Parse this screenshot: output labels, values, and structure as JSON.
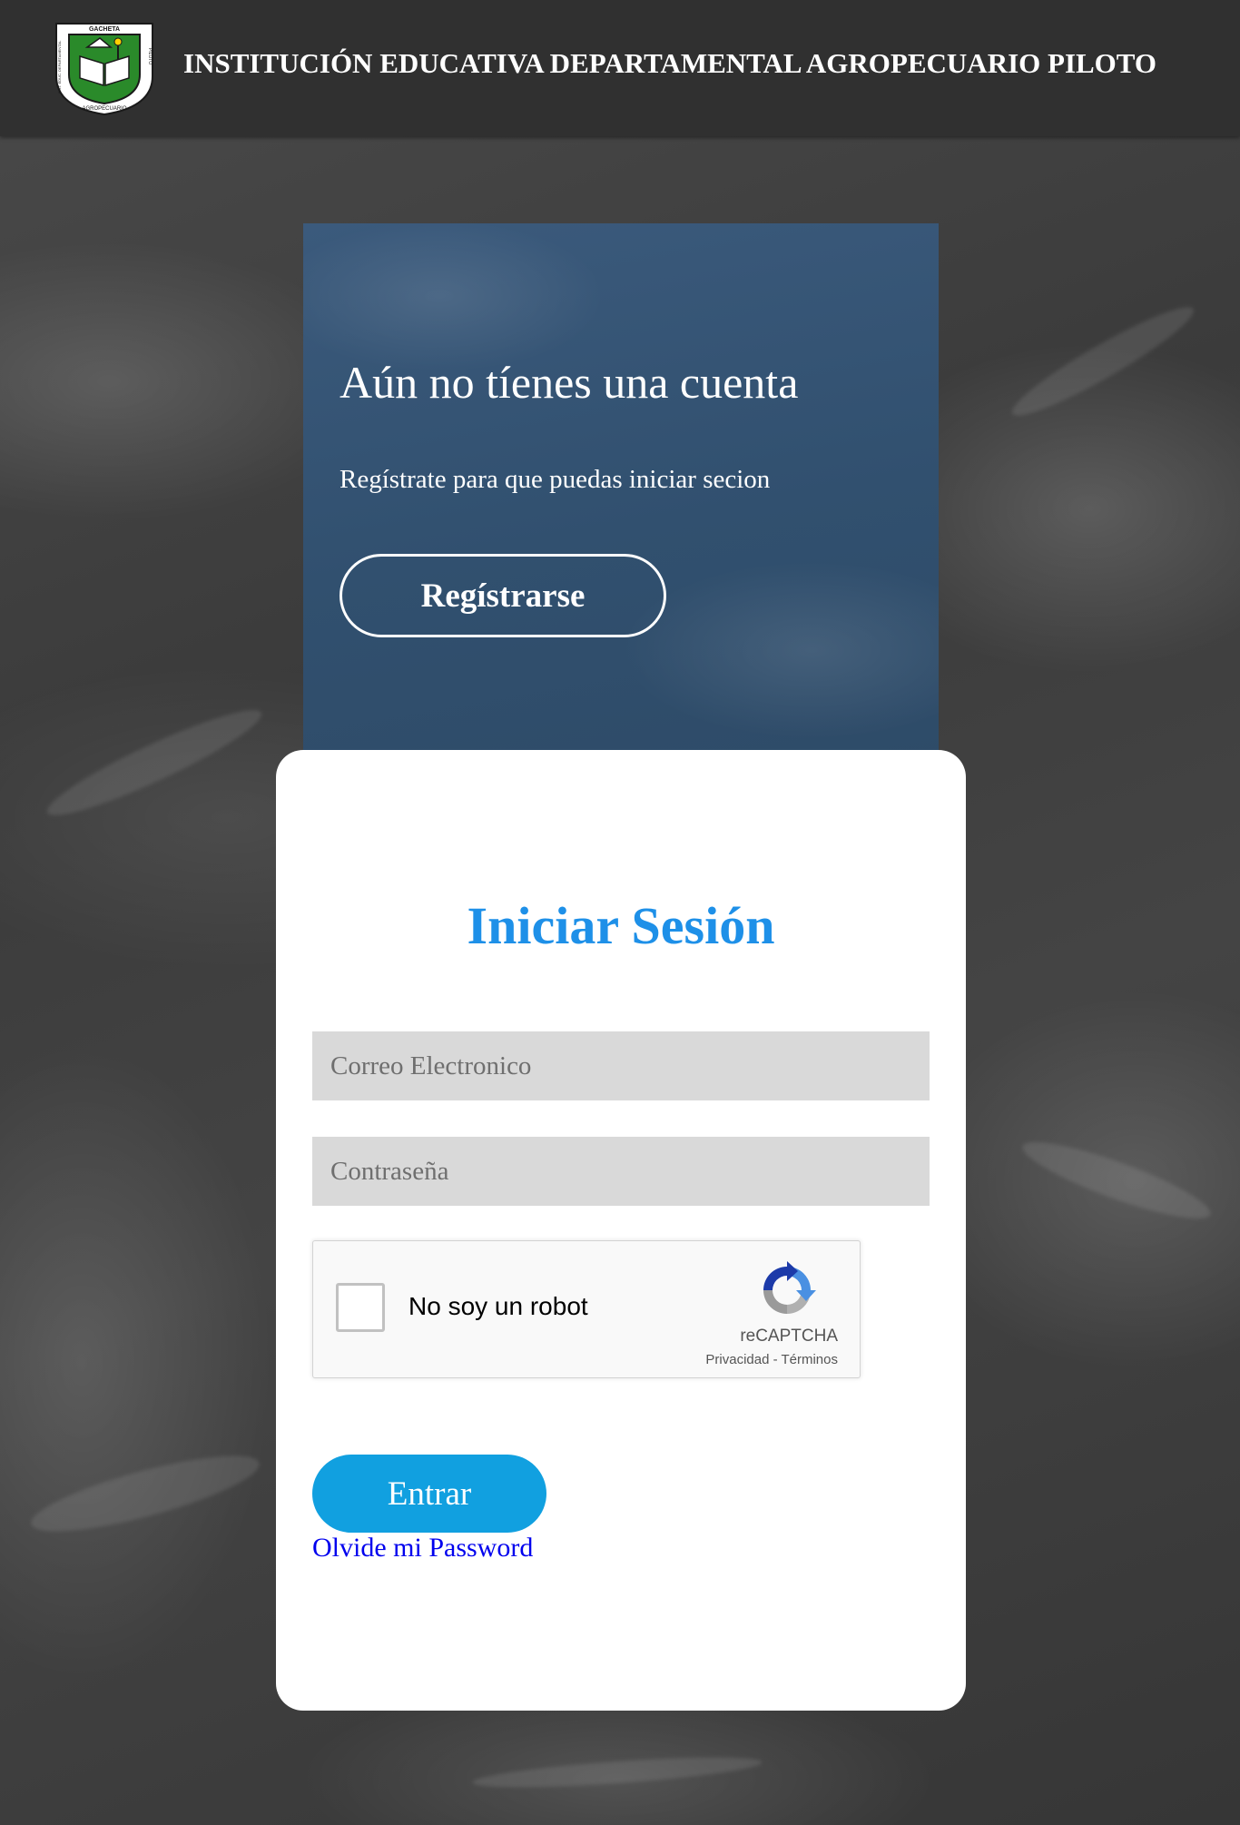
{
  "header": {
    "title": "INSTITUCIÓN EDUCATIVA DEPARTAMENTAL AGROPECUARIO PILOTO",
    "logo": {
      "icon": "school-crest-icon",
      "top_text": "GACHETA",
      "side_text_right": "PILOTO",
      "side_text_left": "INST. EDUC. DEPARTAMENTAL",
      "bottom_text": "AGROPECUARIO",
      "colors": {
        "frame": "#ffffff",
        "field": "#2a8a2a",
        "border": "#1a1a1a"
      }
    }
  },
  "register": {
    "heading": "Aún no tíenes una cuenta",
    "text": "Regístrate para que puedas iniciar secion",
    "button_label": "Regístrarse",
    "panel_color": "#34526f"
  },
  "login": {
    "title": "Iniciar Sesión",
    "title_color": "#1e90e8",
    "email_placeholder": "Correo Electronico",
    "email_value": "",
    "password_placeholder": "Contraseña",
    "password_value": "",
    "captcha": {
      "label": "No soy un robot",
      "brand": "reCAPTCHA",
      "links": "Privacidad - Términos",
      "icon": "recaptcha-icon",
      "checked": false
    },
    "submit_label": "Entrar",
    "submit_color": "#11a0e0",
    "forgot_label": "Olvide mi Password"
  }
}
